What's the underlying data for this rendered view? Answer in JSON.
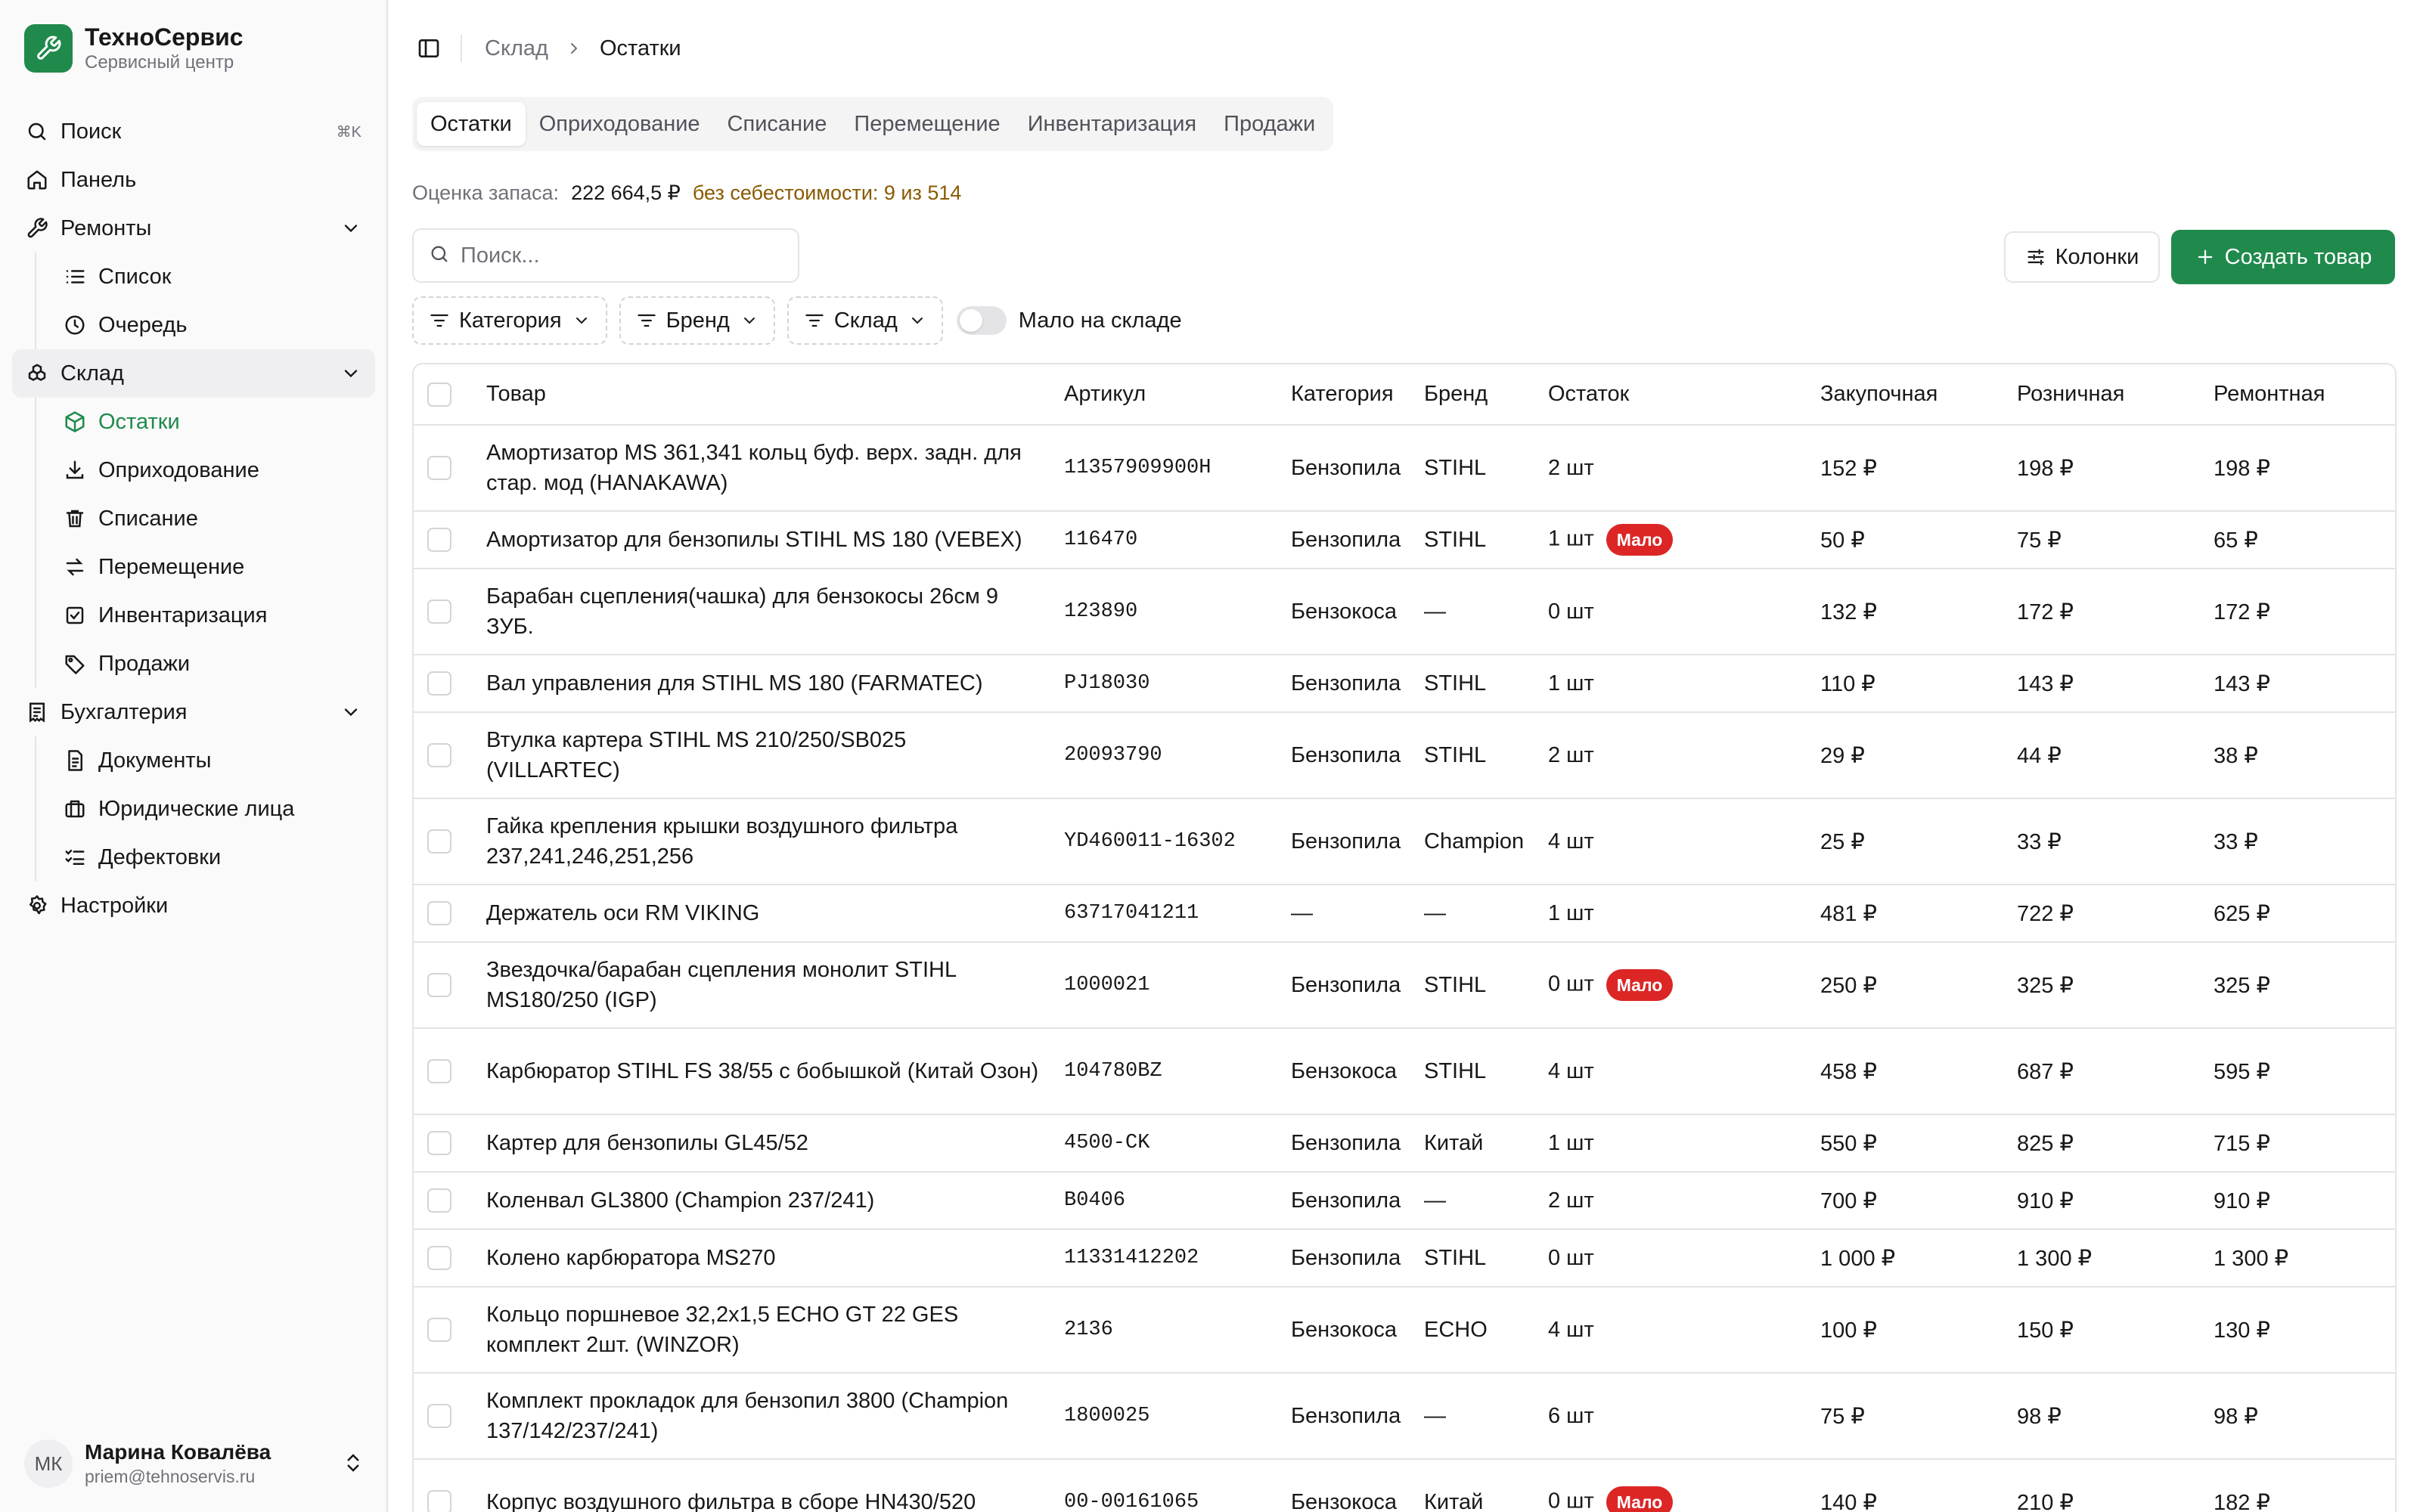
{
  "brand": {
    "name": "ТехноСервис",
    "subtitle": "Сервисный центр"
  },
  "sidebar": {
    "search": {
      "label": "Поиск",
      "shortcut": "⌘K"
    },
    "dashboard": "Панель",
    "repairs": {
      "label": "Ремонты",
      "items": [
        "Список",
        "Очередь"
      ]
    },
    "warehouse": {
      "label": "Склад",
      "items": [
        "Остатки",
        "Оприходование",
        "Списание",
        "Перемещение",
        "Инвентаризация",
        "Продажи"
      ]
    },
    "accounting": {
      "label": "Бухгалтерия",
      "items": [
        "Документы",
        "Юридические лица",
        "Дефектовки"
      ]
    },
    "settings": "Настройки"
  },
  "user": {
    "initials": "МК",
    "name": "Марина Ковалёва",
    "email": "priem@tehnoservis.ru"
  },
  "breadcrumb": {
    "parent": "Склад",
    "current": "Остатки"
  },
  "tabs": [
    "Остатки",
    "Оприходование",
    "Списание",
    "Перемещение",
    "Инвентаризация",
    "Продажи"
  ],
  "stock": {
    "label": "Оценка запаса:",
    "value": "222 664,5 ₽",
    "warning": "без себестоимости: 9 из 514"
  },
  "search": {
    "placeholder": "Поиск..."
  },
  "actions": {
    "columns": "Колонки",
    "create": "Создать товар"
  },
  "filters": {
    "category": "Категория",
    "brand": "Бренд",
    "warehouse": "Склад",
    "low_stock": "Мало на складе"
  },
  "table": {
    "headers": [
      "Товар",
      "Артикул",
      "Категория",
      "Бренд",
      "Остаток",
      "Закупочная",
      "Розничная",
      "Ремонтная"
    ],
    "badge_low": "Мало",
    "rows": [
      {
        "name": "Амортизатор MS 361,341 кольц буф. верх. задн. для стар. мод (HANAKAWA)",
        "sku": "11357909900H",
        "category": "Бензопила",
        "brand": "STIHL",
        "stock": "2 шт",
        "low": false,
        "purchase": "152 ₽",
        "retail": "198 ₽",
        "repair": "198 ₽"
      },
      {
        "name": "Амортизатор для бензопилы STIHL MS 180 (VEBEX)",
        "sku": "116470",
        "category": "Бензопила",
        "brand": "STIHL",
        "stock": "1 шт",
        "low": true,
        "purchase": "50 ₽",
        "retail": "75 ₽",
        "repair": "65 ₽"
      },
      {
        "name": "Барабан сцепления(чашка) для бензокосы 26см 9 ЗУБ.",
        "sku": "123890",
        "category": "Бензокоса",
        "brand": "—",
        "stock": "0 шт",
        "low": false,
        "purchase": "132 ₽",
        "retail": "172 ₽",
        "repair": "172 ₽"
      },
      {
        "name": "Вал управления для STIHL MS 180 (FARMATEC)",
        "sku": "PJ18030",
        "category": "Бензопила",
        "brand": "STIHL",
        "stock": "1 шт",
        "low": false,
        "purchase": "110 ₽",
        "retail": "143 ₽",
        "repair": "143 ₽"
      },
      {
        "name": "Втулка картера STIHL MS 210/250/SB025 (VILLARTEC)",
        "sku": "20093790",
        "category": "Бензопила",
        "brand": "STIHL",
        "stock": "2 шт",
        "low": false,
        "purchase": "29 ₽",
        "retail": "44 ₽",
        "repair": "38 ₽"
      },
      {
        "name": "Гайка крепления крышки воздушного фильтра 237,241,246,251,256",
        "sku": "YD460011-16302",
        "category": "Бензопила",
        "brand": "Champion",
        "stock": "4 шт",
        "low": false,
        "purchase": "25 ₽",
        "retail": "33 ₽",
        "repair": "33 ₽"
      },
      {
        "name": "Держатель оси RM VIKING",
        "sku": "63717041211",
        "category": "—",
        "brand": "—",
        "stock": "1 шт",
        "low": false,
        "purchase": "481 ₽",
        "retail": "722 ₽",
        "repair": "625 ₽"
      },
      {
        "name": "Звездочка/барабан сцепления монолит STIHL MS180/250 (IGP)",
        "sku": "1000021",
        "category": "Бензопила",
        "brand": "STIHL",
        "stock": "0 шт",
        "low": true,
        "purchase": "250 ₽",
        "retail": "325 ₽",
        "repair": "325 ₽"
      },
      {
        "name": "Карбюратор STIHL FS 38/55 с бобышкой (Китай Озон)",
        "sku": "104780BZ",
        "category": "Бензокоса",
        "brand": "STIHL",
        "stock": "4 шт",
        "low": false,
        "purchase": "458 ₽",
        "retail": "687 ₽",
        "repair": "595 ₽"
      },
      {
        "name": "Картер для бензопилы GL45/52",
        "sku": "4500-CK",
        "category": "Бензопила",
        "brand": "Китай",
        "stock": "1 шт",
        "low": false,
        "purchase": "550 ₽",
        "retail": "825 ₽",
        "repair": "715 ₽"
      },
      {
        "name": "Коленвал GL3800 (Champion 237/241)",
        "sku": "B0406",
        "category": "Бензопила",
        "brand": "—",
        "stock": "2 шт",
        "low": false,
        "purchase": "700 ₽",
        "retail": "910 ₽",
        "repair": "910 ₽"
      },
      {
        "name": "Колено карбюратора MS270",
        "sku": "11331412202",
        "category": "Бензопила",
        "brand": "STIHL",
        "stock": "0 шт",
        "low": false,
        "purchase": "1 000 ₽",
        "retail": "1 300 ₽",
        "repair": "1 300 ₽"
      },
      {
        "name": "Кольцо поршневое 32,2х1,5 ECHO GT 22 GES комплект 2шт. (WINZOR)",
        "sku": "2136",
        "category": "Бензокоса",
        "brand": "ECHO",
        "stock": "4 шт",
        "low": false,
        "purchase": "100 ₽",
        "retail": "150 ₽",
        "repair": "130 ₽"
      },
      {
        "name": "Комплект прокладок для бензопил 3800 (Champion 137/142/237/241)",
        "sku": "1800025",
        "category": "Бензопила",
        "brand": "—",
        "stock": "6 шт",
        "low": false,
        "purchase": "75 ₽",
        "retail": "98 ₽",
        "repair": "98 ₽"
      },
      {
        "name": "Корпус воздушного фильтра в сборе HN430/520",
        "sku": "00-00161065",
        "category": "Бензокоса",
        "brand": "Китай",
        "stock": "0 шт",
        "low": true,
        "purchase": "140 ₽",
        "retail": "210 ₽",
        "repair": "182 ₽"
      }
    ]
  }
}
